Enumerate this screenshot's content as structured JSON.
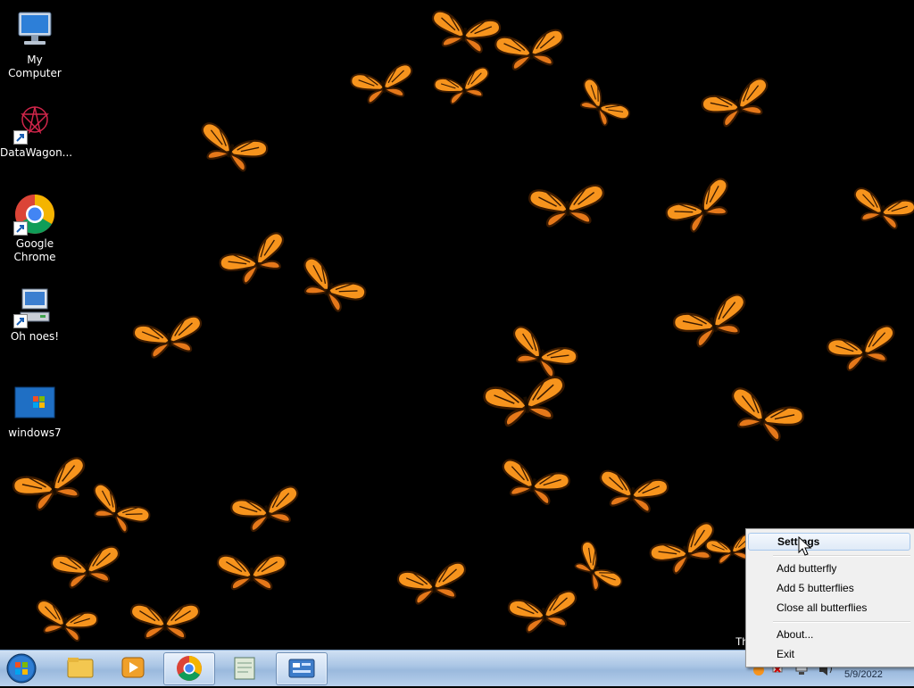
{
  "desktop": {
    "icons": [
      {
        "label": "My Computer",
        "icon": "computer-icon"
      },
      {
        "label": "DataWagon...",
        "icon": "datawagon-icon"
      },
      {
        "label": "Google Chrome",
        "icon": "chrome-icon"
      },
      {
        "label": "Oh noes!",
        "icon": "network-computer-icon"
      },
      {
        "label": "windows7",
        "icon": "windows7-image-icon"
      }
    ],
    "wallpaper_color": "#000000",
    "butterfly_color": "#f7941d",
    "partial_label": "Th"
  },
  "taskbar": {
    "start_icon": "windows-orb-icon",
    "pinned": [
      {
        "icon": "explorer-folder-icon"
      },
      {
        "icon": "media-player-icon"
      },
      {
        "icon": "chrome-icon",
        "active": true
      },
      {
        "icon": "notepad-icon"
      },
      {
        "icon": "control-panel-icon",
        "active": true
      }
    ],
    "tray": {
      "clock_date": "5/9/2022"
    }
  },
  "context_menu": {
    "items": [
      "Settings",
      "Add butterfly",
      "Add 5 butterflies",
      "Close all butterflies",
      "About...",
      "Exit"
    ],
    "hovered": "Settings"
  }
}
